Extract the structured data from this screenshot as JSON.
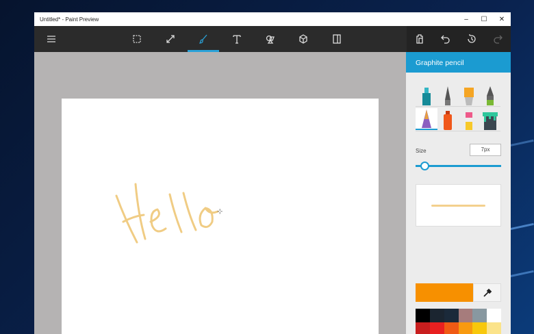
{
  "window": {
    "title": "Untitled* - Paint Preview",
    "minimize": "–",
    "maximize": "☐",
    "close": "✕"
  },
  "toolbar": {
    "tools": [
      {
        "name": "select",
        "active": false
      },
      {
        "name": "crop-resize",
        "active": false
      },
      {
        "name": "brushes",
        "active": true
      },
      {
        "name": "text",
        "active": false
      },
      {
        "name": "stickers",
        "active": false
      },
      {
        "name": "3d-objects",
        "active": false
      },
      {
        "name": "canvas",
        "active": false
      }
    ]
  },
  "panel": {
    "title": "Graphite pencil",
    "size_label": "Size",
    "size_value": "7px",
    "size_fraction": 0.1,
    "current_color": "#f79000",
    "palette": [
      "#000000",
      "#1b2530",
      "#1b2a3a",
      "#a67c7c",
      "#8898a0",
      "#ffffff",
      "#c81e1e",
      "#e82020",
      "#f05a14",
      "#f89a10",
      "#f8c80c",
      "#fbe38a"
    ]
  },
  "canvas": {
    "stroke_color": "#f0cc84"
  }
}
